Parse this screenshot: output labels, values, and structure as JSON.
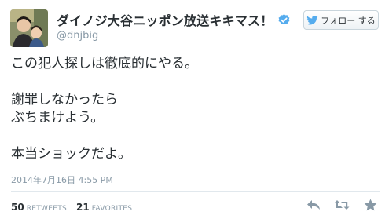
{
  "user": {
    "display_name": "ダイノジ大谷ニッポン放送キキマス！",
    "handle": "@dnjbig"
  },
  "follow_button": {
    "label": "フォロー する"
  },
  "tweet": {
    "text": "この犯人探しは徹底的にやる。\n\n謝罪しなかったら\nぶちまけよう。\n\n本当ショックだよ。",
    "timestamp": "2014年7月16日  4:55 PM"
  },
  "stats": {
    "retweets_count": "50",
    "retweets_label": "RETWEETS",
    "favorites_count": "21",
    "favorites_label": "FAVORITES"
  },
  "icons": {
    "verified": "verified-badge-icon",
    "bird": "twitter-bird-icon",
    "reply": "reply-icon",
    "retweet": "retweet-icon",
    "favorite": "star-icon"
  },
  "colors": {
    "accent": "#55acee",
    "text": "#292f33",
    "muted": "#8899a6"
  }
}
